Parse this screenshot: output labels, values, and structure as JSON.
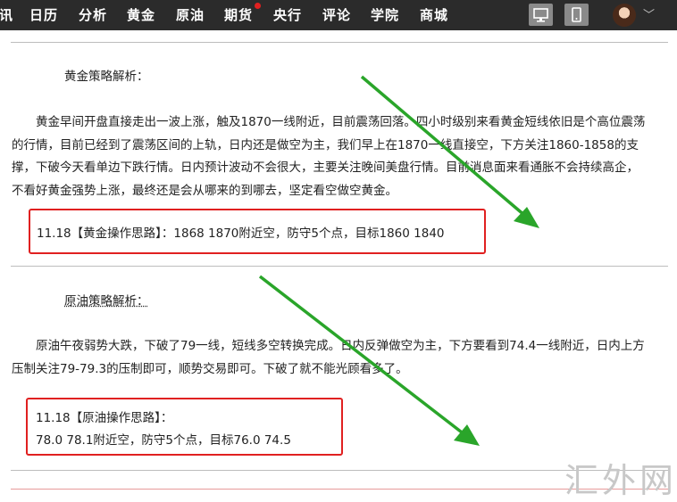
{
  "nav": {
    "items": [
      "讯",
      "日历",
      "分析",
      "黄金",
      "原油",
      "期货",
      "央行",
      "评论",
      "学院",
      "商城"
    ]
  },
  "gold": {
    "heading": "黄金策略解析：",
    "paragraph": "黄金早间开盘直接走出一波上涨，触及1870一线附近，目前震荡回落。四小时级别来看黄金短线依旧是个高位震荡的行情，目前已经到了震荡区间的上轨，日内还是做空为主，我们早上在1870一线直接空，下方关注1860-1858的支撑，下破今天看单边下跌行情。日内预计波动不会很大，主要关注晚间美盘行情。目前消息面来看通胀不会持续高企，不看好黄金强势上涨，最终还是会从哪来的到哪去，坚定看空做空黄金。",
    "plan": "11.18【黄金操作思路】：1868  1870附近空，防守5个点，目标1860  1840"
  },
  "oil": {
    "heading": "原油策略解析：",
    "paragraph": "原油午夜弱势大跌，下破了79一线，短线多空转换完成。日内反弹做空为主，下方要看到74.4一线附近，日内上方压制关注79-79.3的压制即可，顺势交易即可。下破了就不能光顾看多了。",
    "plan_line1": "11.18【原油操作思路】：",
    "plan_line2": "78.0  78.1附近空，防守5个点，目标76.0  74.5"
  },
  "watermark": "汇外网",
  "colors": {
    "arrow": "#2aa52a",
    "highlight_box": "#e02020",
    "topbar": "#2b2b2b"
  }
}
